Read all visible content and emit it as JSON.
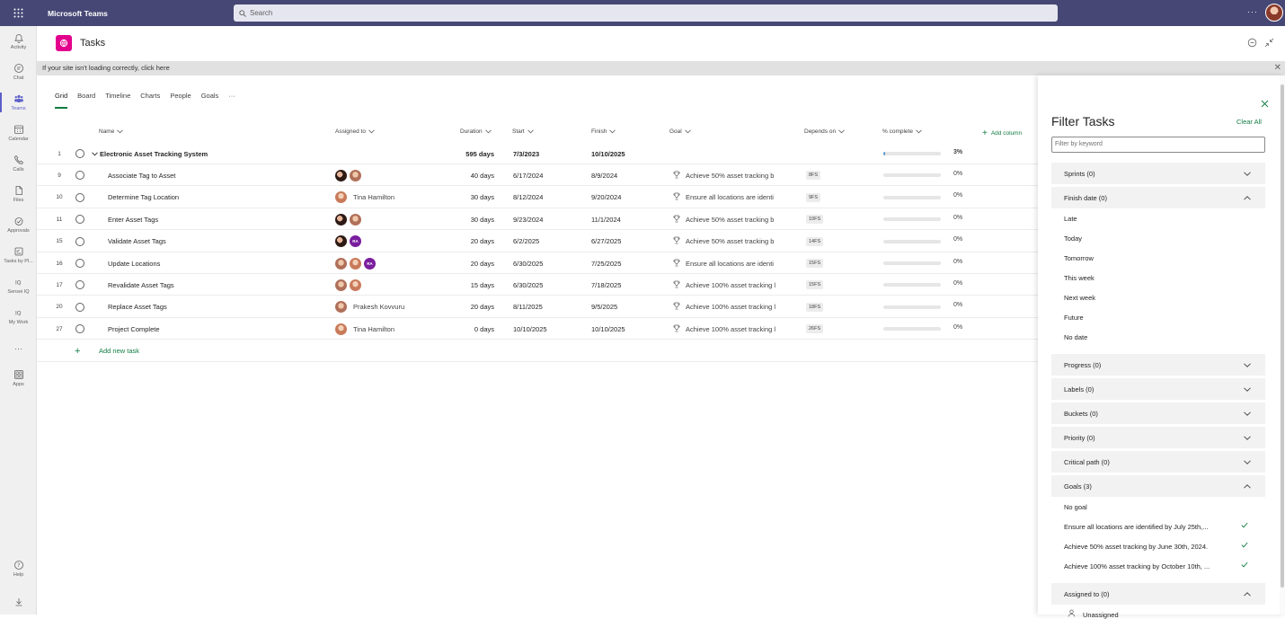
{
  "app": {
    "brand": "Microsoft Teams",
    "search_placeholder": "Search",
    "more": "···"
  },
  "rail": [
    {
      "label": "Activity",
      "icon": "bell-icon"
    },
    {
      "label": "Chat",
      "icon": "chat-icon"
    },
    {
      "label": "Teams",
      "icon": "teams-icon",
      "active": true
    },
    {
      "label": "Calendar",
      "icon": "calendar-icon"
    },
    {
      "label": "Calls",
      "icon": "phone-icon"
    },
    {
      "label": "Files",
      "icon": "file-icon"
    },
    {
      "label": "Approvals",
      "icon": "approvals-icon"
    },
    {
      "label": "Tasks by Pl...",
      "icon": "tasks-icon"
    },
    {
      "label": "Sensei IQ",
      "icon": "iq-icon"
    },
    {
      "label": "My Work",
      "icon": "iq-icon"
    },
    {
      "label": "···",
      "icon": "more-icon"
    },
    {
      "label": "Apps",
      "icon": "apps-icon"
    }
  ],
  "rail_bottom": {
    "help": "Help"
  },
  "header": {
    "title": "Tasks"
  },
  "banner": {
    "text": "If your site isn't loading correctly, click here"
  },
  "tabs": [
    "Grid",
    "Board",
    "Timeline",
    "Charts",
    "People",
    "Goals",
    "···"
  ],
  "columns": {
    "name": "Name",
    "assigned": "Assigned to",
    "duration": "Duration",
    "start": "Start",
    "finish": "Finish",
    "goal": "Goal",
    "depends": "Depends on",
    "pct": "% complete",
    "add": "Add column"
  },
  "tasks": [
    {
      "num": "1",
      "name": "Electronic Asset Tracking System",
      "summary": true,
      "assignees": [],
      "assignee_name": "",
      "duration": "595 days",
      "start": "7/3/2023",
      "finish": "10/10/2025",
      "goal": "",
      "depends": "",
      "pct_label": "3%",
      "pct": 3
    },
    {
      "num": "9",
      "name": "Associate Tag to Asset",
      "assignees": [
        "a1",
        "a2"
      ],
      "assignee_name": "",
      "duration": "40 days",
      "start": "6/17/2024",
      "finish": "8/9/2024",
      "goal": "Achieve 50% asset tracking b",
      "depends": "8FS",
      "pct_label": "0%",
      "pct": 0
    },
    {
      "num": "10",
      "name": "Determine Tag Location",
      "assignees": [
        "a3"
      ],
      "assignee_name": "Tina Hamilton",
      "duration": "30 days",
      "start": "8/12/2024",
      "finish": "9/20/2024",
      "goal": "Ensure all locations are identi",
      "depends": "9FS",
      "pct_label": "0%",
      "pct": 0
    },
    {
      "num": "11",
      "name": "Enter Asset Tags",
      "assignees": [
        "a1",
        "a2"
      ],
      "assignee_name": "",
      "duration": "30 days",
      "start": "9/23/2024",
      "finish": "11/1/2024",
      "goal": "Achieve 50% asset tracking b",
      "depends": "10FS",
      "pct_label": "0%",
      "pct": 0
    },
    {
      "num": "15",
      "name": "Validate Asset Tags",
      "assignees": [
        "a1",
        "ra"
      ],
      "assignee_name": "",
      "duration": "20 days",
      "start": "6/2/2025",
      "finish": "6/27/2025",
      "goal": "Achieve 50% asset tracking b",
      "depends": "14FS",
      "pct_label": "0%",
      "pct": 0
    },
    {
      "num": "16",
      "name": "Update Locations",
      "assignees": [
        "a2",
        "a3",
        "ra"
      ],
      "assignee_name": "",
      "duration": "20 days",
      "start": "6/30/2025",
      "finish": "7/25/2025",
      "goal": "Ensure all locations are identi",
      "depends": "15FS",
      "pct_label": "0%",
      "pct": 0
    },
    {
      "num": "17",
      "name": "Revalidate Asset Tags",
      "assignees": [
        "a2",
        "a3"
      ],
      "assignee_name": "",
      "duration": "15 days",
      "start": "6/30/2025",
      "finish": "7/18/2025",
      "goal": "Achieve 100% asset tracking l",
      "depends": "15FS",
      "pct_label": "0%",
      "pct": 0
    },
    {
      "num": "20",
      "name": "Replace Asset Tags",
      "assignees": [
        "a2"
      ],
      "assignee_name": "Prakesh Kovvuru",
      "duration": "20 days",
      "start": "8/11/2025",
      "finish": "9/5/2025",
      "goal": "Achieve 100% asset tracking l",
      "depends": "18FS",
      "pct_label": "0%",
      "pct": 0
    },
    {
      "num": "27",
      "name": "Project Complete",
      "assignees": [
        "a3"
      ],
      "assignee_name": "Tina Hamilton",
      "duration": "0 days",
      "start": "10/10/2025",
      "finish": "10/10/2025",
      "goal": "Achieve 100% asset tracking l",
      "depends": "26FS",
      "pct_label": "0%",
      "pct": 0
    }
  ],
  "add_task": "Add new task",
  "avatar_initials": "RA",
  "filter": {
    "title": "Filter Tasks",
    "clear_all": "Clear All",
    "keyword_placeholder": "Filter by keyword",
    "sections": [
      {
        "label": "Sprints (0)",
        "expanded": false,
        "options": []
      },
      {
        "label": "Finish date (0)",
        "expanded": true,
        "options": [
          {
            "label": "Late"
          },
          {
            "label": "Today"
          },
          {
            "label": "Tomorrow"
          },
          {
            "label": "This week"
          },
          {
            "label": "Next week"
          },
          {
            "label": "Future"
          },
          {
            "label": "No date"
          }
        ]
      },
      {
        "label": "Progress (0)",
        "expanded": false,
        "options": []
      },
      {
        "label": "Labels (0)",
        "expanded": false,
        "options": []
      },
      {
        "label": "Buckets (0)",
        "expanded": false,
        "options": []
      },
      {
        "label": "Priority (0)",
        "expanded": false,
        "options": []
      },
      {
        "label": "Critical path (0)",
        "expanded": false,
        "options": []
      },
      {
        "label": "Goals (3)",
        "expanded": true,
        "options": [
          {
            "label": "No goal"
          },
          {
            "label": "Ensure all locations are identified by July 25th,...",
            "checked": true
          },
          {
            "label": "Achieve 50% asset tracking by June 30th, 2024.",
            "checked": true
          },
          {
            "label": "Achieve 100% asset tracking by October 10th, ...",
            "checked": true
          }
        ]
      },
      {
        "label": "Assigned to (0)",
        "expanded": true,
        "options": [
          {
            "label": "Unassigned",
            "icon": "person-icon"
          }
        ]
      }
    ]
  },
  "colors": {
    "brand_bar": "#464775",
    "accent": "#107c41",
    "tasks_logo": "#e3008c",
    "teams_active": "#5b5fc7"
  }
}
